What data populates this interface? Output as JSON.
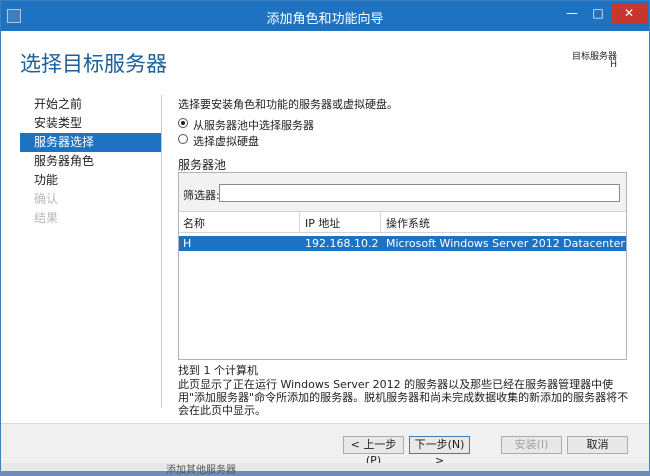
{
  "window": {
    "title": "添加角色和功能向导",
    "controls": {
      "minimize": "—",
      "maximize": "□",
      "close": "✕"
    }
  },
  "header": {
    "title": "选择目标服务器",
    "target_label": "目标服务器",
    "target_value": "H"
  },
  "nav": {
    "items": [
      {
        "label": "开始之前",
        "state": "normal"
      },
      {
        "label": "安装类型",
        "state": "normal"
      },
      {
        "label": "服务器选择",
        "state": "active"
      },
      {
        "label": "服务器角色",
        "state": "normal"
      },
      {
        "label": "功能",
        "state": "normal"
      },
      {
        "label": "确认",
        "state": "disabled"
      },
      {
        "label": "结果",
        "state": "disabled"
      }
    ]
  },
  "main": {
    "instruction": "选择要安装角色和功能的服务器或虚拟硬盘。",
    "options": [
      {
        "label": "从服务器池中选择服务器",
        "checked": true
      },
      {
        "label": "选择虚拟硬盘",
        "checked": false
      }
    ],
    "pool": {
      "title": "服务器池",
      "filter_label": "筛选器:",
      "filter_value": "",
      "columns": [
        "名称",
        "IP 地址",
        "操作系统"
      ],
      "rows": [
        {
          "name": "H",
          "ip": "192.168.10.2",
          "os": "Microsoft Windows Server 2012 Datacenter"
        }
      ]
    },
    "found": "找到 1 个计算机",
    "description": "此页显示了正在运行 Windows Server 2012 的服务器以及那些已经在服务器管理器中使用\"添加服务器\"命令所添加的服务器。脱机服务器和尚未完成数据收集的新添加的服务器将不会在此页中显示。"
  },
  "footer": {
    "prev": "< 上一步(P)",
    "next": "下一步(N) >",
    "install": "安装(I)",
    "cancel": "取消"
  },
  "background": {
    "status_text": "添加其他服务器"
  },
  "colors": {
    "accent": "#1d73c2",
    "close": "#c7372f"
  }
}
